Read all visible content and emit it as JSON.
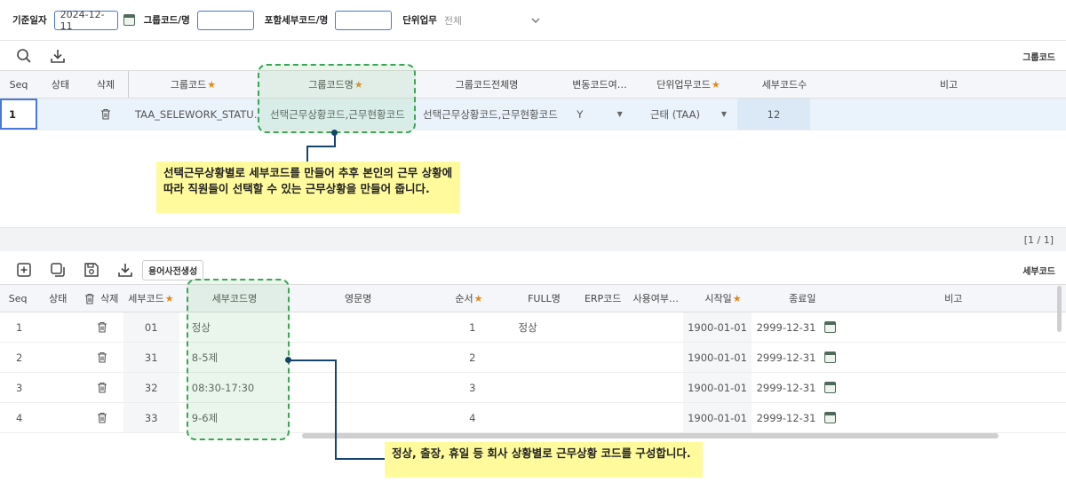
{
  "filters": {
    "base_date_label": "기준일자",
    "base_date_value": "2024-12-11",
    "group_code_label": "그룹코드/명",
    "group_code_value": "",
    "sub_code_label": "포함세부코드/명",
    "sub_code_value": "",
    "unit_task_label": "단위업무",
    "unit_task_value": "전체"
  },
  "group_panel": {
    "title": "그룹코드",
    "columns": [
      "Seq",
      "상태",
      "삭제",
      "그룹코드",
      "그룹코드명",
      "그룹코드전체명",
      "변동코드여…",
      "단위업무코드",
      "세부코드수",
      "비고"
    ],
    "rows": [
      {
        "seq": "1",
        "status": "",
        "code": "TAA_SELEWORK_STATU…",
        "name": "선택근무상황코드,근무현황코드",
        "full_name": "선택근무상황코드,근무현황코드",
        "variable": "Y",
        "unit_code": "근태 (TAA)",
        "sub_count": "12",
        "note": ""
      }
    ],
    "pager": "[1 / 1]"
  },
  "detail_panel": {
    "title": "세부코드",
    "dict_button": "용어사전생성",
    "columns": [
      "Seq",
      "상태",
      "삭제",
      "세부코드",
      "세부코드명",
      "영문명",
      "순서",
      "FULL명",
      "ERP코드",
      "사용여부…",
      "시작일",
      "종료일",
      "비고"
    ],
    "rows": [
      {
        "seq": "1",
        "code": "01",
        "name": "정상",
        "eng": "",
        "order": "1",
        "full": "정상",
        "start": "1900-01-01",
        "end": "2999-12-31"
      },
      {
        "seq": "2",
        "code": "31",
        "name": "8-5제",
        "eng": "",
        "order": "2",
        "full": "",
        "start": "1900-01-01",
        "end": "2999-12-31"
      },
      {
        "seq": "3",
        "code": "32",
        "name": "08:30-17:30",
        "eng": "",
        "order": "3",
        "full": "",
        "start": "1900-01-01",
        "end": "2999-12-31"
      },
      {
        "seq": "4",
        "code": "33",
        "name": "9-6제",
        "eng": "",
        "order": "4",
        "full": "",
        "start": "1900-01-01",
        "end": "2999-12-31"
      }
    ]
  },
  "annotations": {
    "top_callout": "선택근무상황별로 세부코드를 만들어 추후 본인의 근무 상황에 따라 직원들이 선택할 수 있는 근무상황을 만들어 줍니다.",
    "bottom_callout": "정상, 출장, 휴일 등 회사 상황별로 근무상황 코드를 구성합니다."
  },
  "colors": {
    "accent": "#4a78d6",
    "required_star": "#e08a17",
    "callout_bg": "#fffb9c",
    "highlight_border": "#3aa655"
  }
}
